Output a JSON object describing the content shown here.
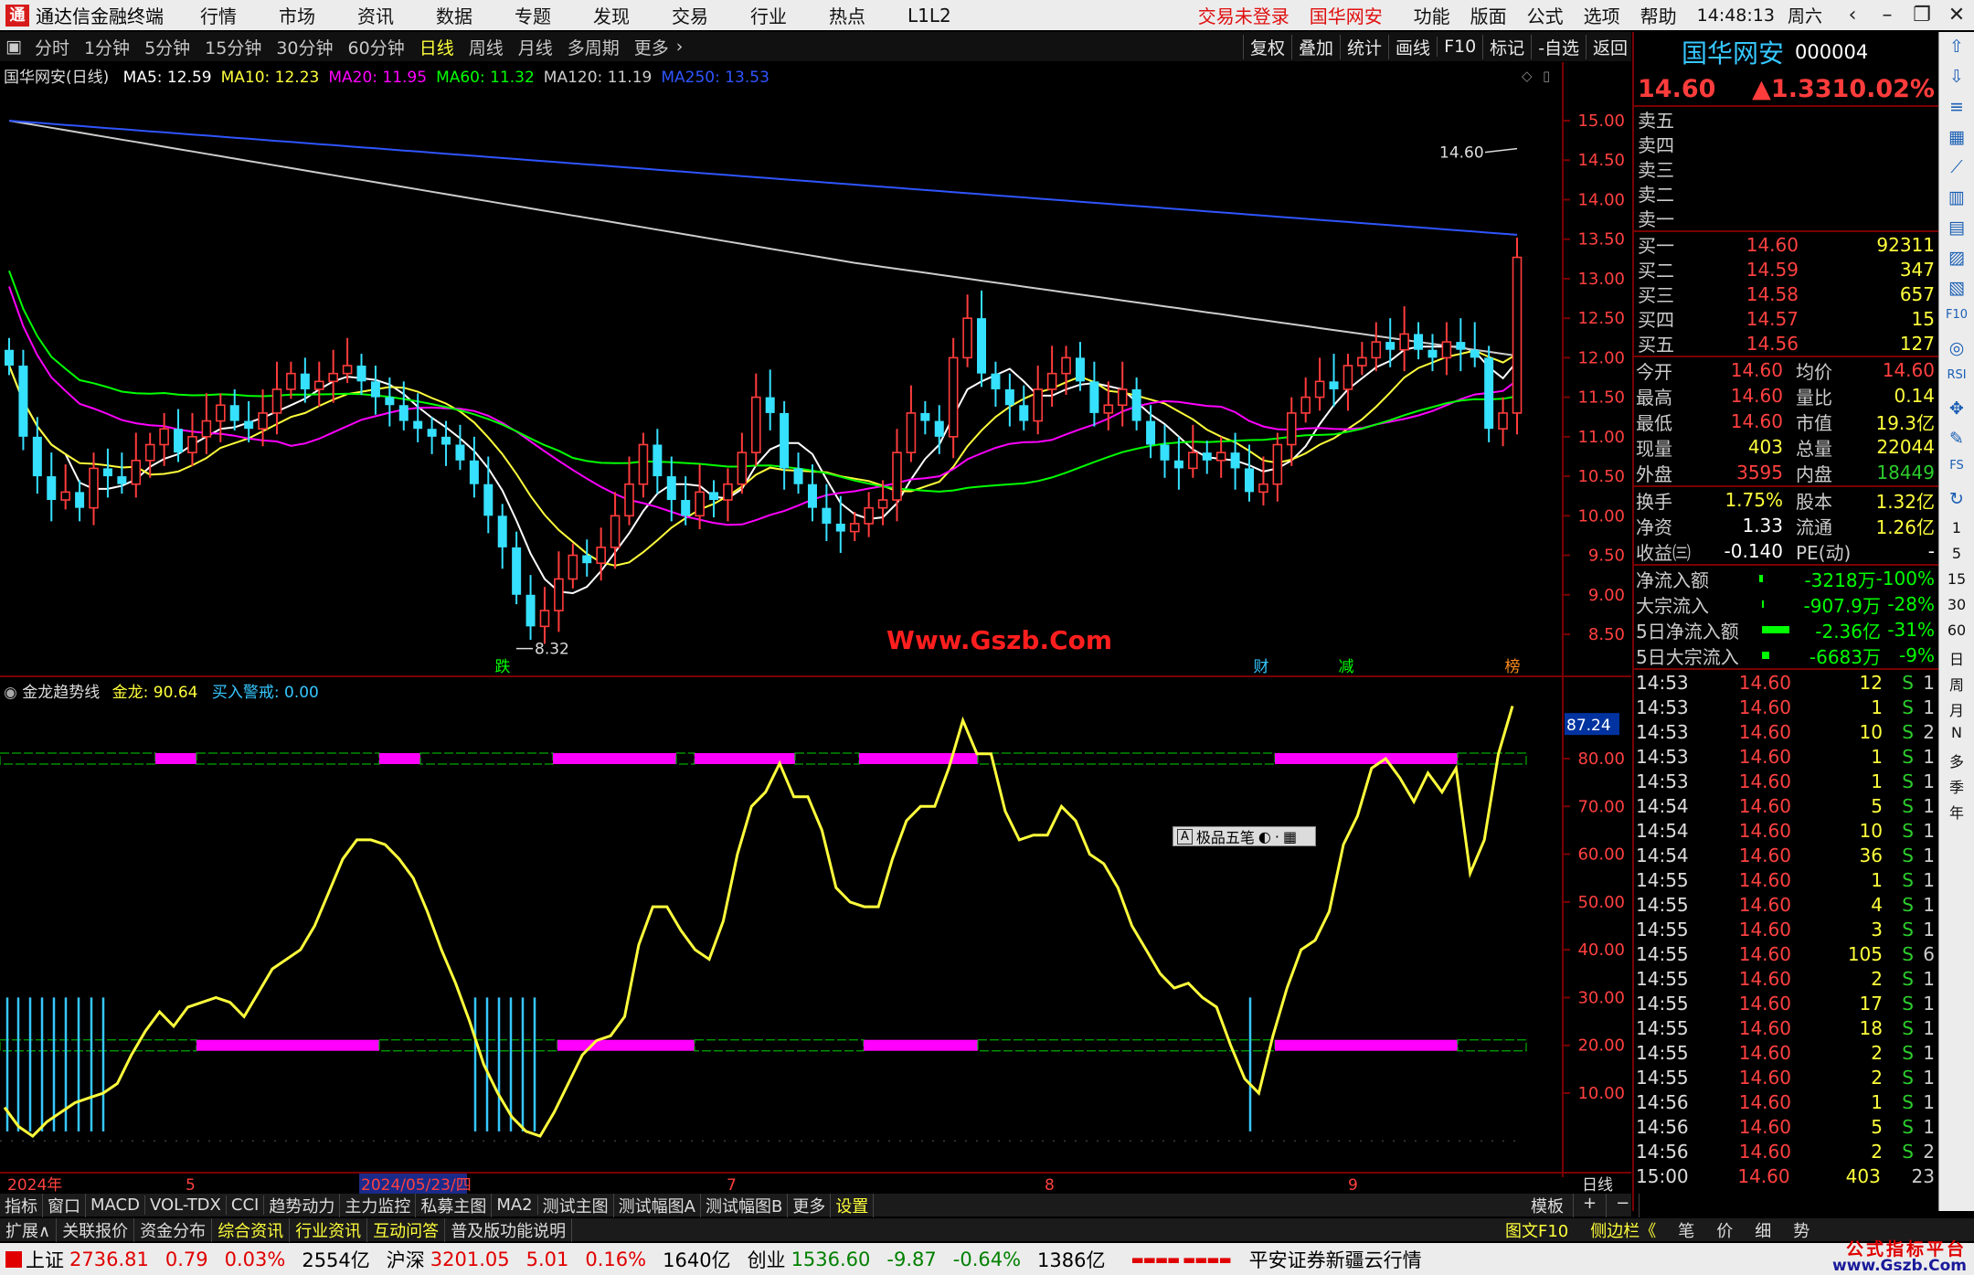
{
  "titlebar": {
    "app_name": "通达信金融终端",
    "menus": [
      "行情",
      "市场",
      "资讯",
      "数据",
      "专题",
      "发现",
      "交易",
      "行业",
      "热点",
      "L1L2"
    ],
    "trade_status": "交易未登录",
    "stock_name": "国华网安",
    "right_menus": [
      "功能",
      "版面",
      "公式",
      "选项",
      "帮助"
    ],
    "time": "14:48:13",
    "weekday": "周六"
  },
  "periodbar": {
    "periods": [
      "分时",
      "1分钟",
      "5分钟",
      "15分钟",
      "30分钟",
      "60分钟",
      "日线",
      "周线",
      "月线",
      "多周期",
      "更多"
    ],
    "active": "日线",
    "tools": [
      "复权",
      "叠加",
      "统计",
      "画线",
      "F10",
      "标记",
      "-自选",
      "返回"
    ]
  },
  "main_chart": {
    "stock_title": "国华网安(日线)",
    "ma": [
      {
        "label": "MA5",
        "value": "12.59",
        "color": "#ffffff"
      },
      {
        "label": "MA10",
        "value": "12.23",
        "color": "#ffff3c"
      },
      {
        "label": "MA20",
        "value": "11.95",
        "color": "#ff00ff"
      },
      {
        "label": "MA60",
        "value": "11.32",
        "color": "#00ff00"
      },
      {
        "label": "MA120",
        "value": "11.19",
        "color": "#cccccc"
      },
      {
        "label": "MA250",
        "value": "13.53",
        "color": "#2f55ff"
      }
    ],
    "yticks": [
      "15.00",
      "14.50",
      "14.00",
      "13.50",
      "13.00",
      "12.50",
      "12.00",
      "11.50",
      "11.00",
      "10.50",
      "10.00",
      "9.50",
      "9.00",
      "8.50"
    ],
    "high_annotation": "14.60",
    "low_annotation": "8.32",
    "markers": [
      {
        "text": "跌"
      },
      {
        "text": "财"
      },
      {
        "text": "减"
      },
      {
        "text": "榜"
      }
    ],
    "watermark": "Www.Gszb.Com"
  },
  "indicator": {
    "name": "金龙趋势线",
    "label1": "金龙:",
    "value1": "90.64",
    "label2": "买入警戒:",
    "value2": "0.00",
    "current": "87.24",
    "yticks": [
      "80.00",
      "70.00",
      "60.00",
      "50.00",
      "40.00",
      "30.00",
      "20.00",
      "10.00"
    ],
    "tooltip": "极品五笔"
  },
  "chart_data": {
    "type": "line",
    "series": [
      {
        "name": "金龙",
        "values": [
          7,
          3,
          1,
          4,
          6,
          8,
          9,
          10,
          12,
          18,
          23,
          27,
          24,
          28,
          29,
          30,
          29,
          26,
          31,
          36,
          38,
          40,
          45,
          52,
          59,
          63,
          63,
          62,
          59,
          55,
          48,
          40,
          33,
          25,
          16,
          10,
          5,
          2,
          1,
          6,
          12,
          18,
          21,
          22,
          26,
          41,
          49,
          49,
          44,
          40,
          38,
          46,
          60,
          70,
          73,
          79,
          72,
          72,
          65,
          53,
          50,
          49,
          49,
          59,
          67,
          70,
          70,
          78,
          88,
          81,
          81,
          69,
          63,
          64,
          64,
          70,
          67,
          60,
          58,
          53,
          45,
          40,
          35,
          32,
          33,
          30,
          28,
          20,
          13,
          10,
          22,
          32,
          40,
          42,
          48,
          62,
          68,
          78,
          80,
          76,
          71,
          77,
          73,
          78,
          56,
          63,
          81,
          91
        ]
      }
    ],
    "ylim": [
      0,
      100
    ]
  },
  "sidepanel": {
    "name": "国华网安",
    "code": "000004",
    "price": "14.60",
    "change": "▲1.33",
    "pct": "10.02%",
    "ask_labels": [
      "卖五",
      "卖四",
      "卖三",
      "卖二",
      "卖一"
    ],
    "bids": [
      {
        "label": "买一",
        "price": "14.60",
        "vol": "92311"
      },
      {
        "label": "买二",
        "price": "14.59",
        "vol": "347"
      },
      {
        "label": "买三",
        "price": "14.58",
        "vol": "657"
      },
      {
        "label": "买四",
        "price": "14.57",
        "vol": "15"
      },
      {
        "label": "买五",
        "price": "14.56",
        "vol": "127"
      }
    ],
    "stats": [
      {
        "l": "今开",
        "v": "14.60",
        "vc": "#ff4040",
        "l2": "均价",
        "v2": "14.60",
        "v2c": "#ff4040"
      },
      {
        "l": "最高",
        "v": "14.60",
        "vc": "#ff4040",
        "l2": "量比",
        "v2": "0.14",
        "v2c": "#ffff3c"
      },
      {
        "l": "最低",
        "v": "14.60",
        "vc": "#ff4040",
        "l2": "市值",
        "v2": "19.3亿",
        "v2c": "#ffff3c"
      },
      {
        "l": "现量",
        "v": "403",
        "vc": "#ffff3c",
        "l2": "总量",
        "v2": "22044",
        "v2c": "#ffff3c"
      },
      {
        "l": "外盘",
        "v": "3595",
        "vc": "#ff4040",
        "l2": "内盘",
        "v2": "18449",
        "v2c": "#2ccd2c"
      }
    ],
    "stats2": [
      {
        "l": "换手",
        "v": "1.75%",
        "vc": "#ffff3c",
        "l2": "股本",
        "v2": "1.32亿",
        "v2c": "#ffff3c"
      },
      {
        "l": "净资",
        "v": "1.33",
        "vc": "#ffffff",
        "l2": "流通",
        "v2": "1.26亿",
        "v2c": "#ffff3c"
      },
      {
        "l": "收益㈢",
        "v": "-0.140",
        "vc": "#ffffff",
        "l2": "PE(动)",
        "v2": "-",
        "v2c": "#ffffff"
      }
    ],
    "flows": [
      {
        "l": "净流入额",
        "v": "-3218万",
        "p": "-100%",
        "bar": "#0f0",
        "barw": 4
      },
      {
        "l": "大宗流入",
        "v": "-907.9万",
        "p": "-28%",
        "bar": "#0f0",
        "barw": 2
      },
      {
        "l": "5日净流入额",
        "v": "-2.36亿",
        "p": "-31%",
        "bar": "#0f0",
        "barw": 30
      },
      {
        "l": "5日大宗流入",
        "v": "-6683万",
        "p": "-9%",
        "bar": "#0f0",
        "barw": 8
      }
    ],
    "ticks": [
      {
        "t": "14:53",
        "p": "14.60",
        "v": "12",
        "s": "S",
        "n": "1"
      },
      {
        "t": "14:53",
        "p": "14.60",
        "v": "1",
        "s": "S",
        "n": "1"
      },
      {
        "t": "14:53",
        "p": "14.60",
        "v": "10",
        "s": "S",
        "n": "2"
      },
      {
        "t": "14:53",
        "p": "14.60",
        "v": "1",
        "s": "S",
        "n": "1"
      },
      {
        "t": "14:53",
        "p": "14.60",
        "v": "1",
        "s": "S",
        "n": "1"
      },
      {
        "t": "14:54",
        "p": "14.60",
        "v": "5",
        "s": "S",
        "n": "1"
      },
      {
        "t": "14:54",
        "p": "14.60",
        "v": "10",
        "s": "S",
        "n": "1"
      },
      {
        "t": "14:54",
        "p": "14.60",
        "v": "36",
        "s": "S",
        "n": "1"
      },
      {
        "t": "14:55",
        "p": "14.60",
        "v": "1",
        "s": "S",
        "n": "1"
      },
      {
        "t": "14:55",
        "p": "14.60",
        "v": "4",
        "s": "S",
        "n": "1"
      },
      {
        "t": "14:55",
        "p": "14.60",
        "v": "3",
        "s": "S",
        "n": "1"
      },
      {
        "t": "14:55",
        "p": "14.60",
        "v": "105",
        "s": "S",
        "n": "6"
      },
      {
        "t": "14:55",
        "p": "14.60",
        "v": "2",
        "s": "S",
        "n": "1"
      },
      {
        "t": "14:55",
        "p": "14.60",
        "v": "17",
        "s": "S",
        "n": "1"
      },
      {
        "t": "14:55",
        "p": "14.60",
        "v": "18",
        "s": "S",
        "n": "1"
      },
      {
        "t": "14:55",
        "p": "14.60",
        "v": "2",
        "s": "S",
        "n": "1"
      },
      {
        "t": "14:55",
        "p": "14.60",
        "v": "2",
        "s": "S",
        "n": "1"
      },
      {
        "t": "14:56",
        "p": "14.60",
        "v": "1",
        "s": "S",
        "n": "1"
      },
      {
        "t": "14:56",
        "p": "14.60",
        "v": "5",
        "s": "S",
        "n": "1"
      },
      {
        "t": "14:56",
        "p": "14.60",
        "v": "2",
        "s": "S",
        "n": "2"
      },
      {
        "t": "15:00",
        "p": "14.60",
        "v": "403",
        "s": "",
        "n": "23"
      }
    ]
  },
  "rightstrip": {
    "icons": [
      "up-icon",
      "down-icon",
      "list-icon",
      "grid-icon",
      "chart-icon",
      "k-icon",
      "table-icon",
      "info-icon",
      "doc-icon",
      "f10-icon",
      "target-icon",
      "rsi-icon",
      "move-icon",
      "pen-icon",
      "fs-icon",
      "refresh-icon"
    ],
    "labels": [
      "1",
      "5",
      "15",
      "30",
      "60",
      "日",
      "周",
      "月",
      "N",
      "多",
      "季",
      "年"
    ]
  },
  "xaxis": {
    "labels": [
      "2024年",
      "5",
      "2024/05/23/四",
      "7",
      "8",
      "9"
    ],
    "period": "日线"
  },
  "tabbar": {
    "tabs": [
      "指标",
      "窗口",
      "MACD",
      "VOL-TDX",
      "CCI",
      "趋势动力",
      "主力监控",
      "私募主图",
      "MA2",
      "测试主图",
      "测试幅图A",
      "测试幅图B",
      "更多",
      "设置"
    ],
    "active": "设置",
    "right": [
      "模板",
      "+",
      "−"
    ]
  },
  "bottomrow2": {
    "tabs": [
      "扩展∧",
      "关联报价",
      "资金分布",
      "综合资讯",
      "行业资讯",
      "互动问答",
      "普及版功能说明"
    ],
    "right": [
      "图文F10",
      "侧边栏《",
      "笔",
      "价",
      "细",
      "势"
    ]
  },
  "statusbar": {
    "items": [
      {
        "name": "上证",
        "v": "2736.81",
        "c": "0.79",
        "p": "0.03%",
        "amt": "2554亿"
      },
      {
        "name": "沪深",
        "v": "3201.05",
        "c": "5.01",
        "p": "0.16%",
        "amt": "1640亿"
      },
      {
        "name": "创业",
        "v": "1536.60",
        "c": "-9.87",
        "p": "-0.64%",
        "amt": "1386亿"
      }
    ],
    "broker": "平安证券新疆云行情",
    "watermark": "公式指标平台",
    "watermark2": "www.Gszb.Com"
  }
}
